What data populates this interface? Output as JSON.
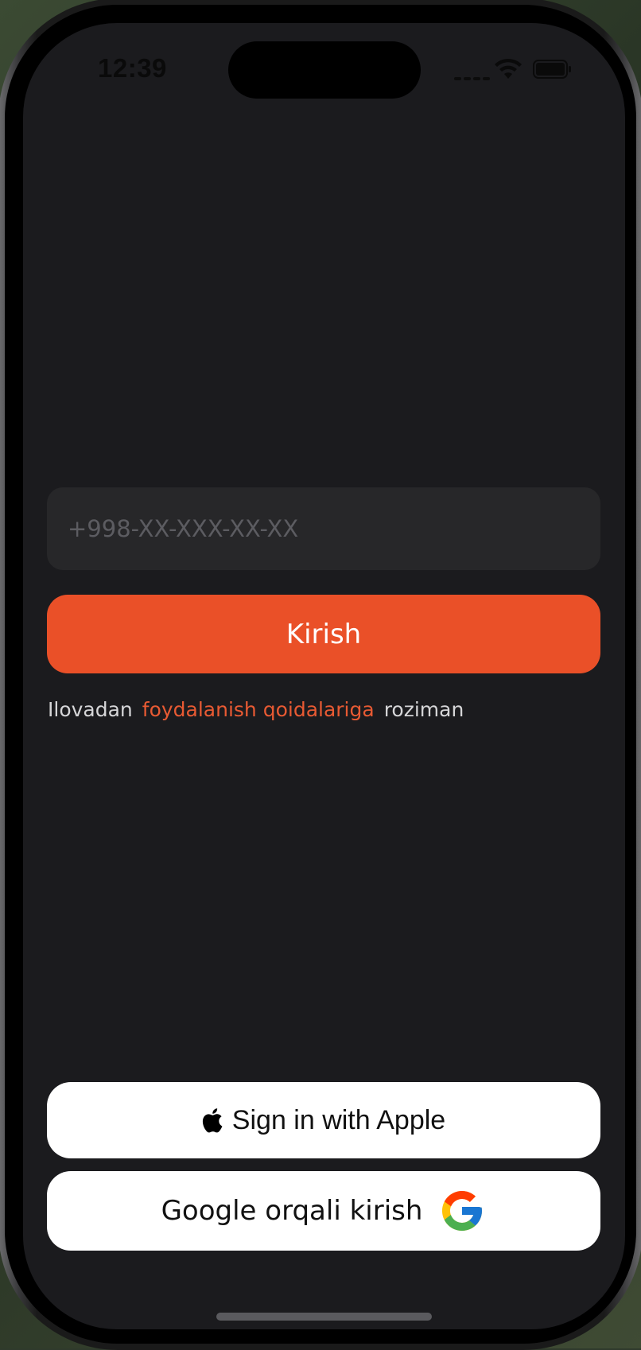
{
  "status_bar": {
    "time": "12:39"
  },
  "login": {
    "phone_placeholder": "+998-XX-XXX-XX-XX",
    "submit_label": "Kirish"
  },
  "terms": {
    "prefix": "Ilovadan",
    "link": "foydalanish qoidalariga",
    "suffix": "roziman"
  },
  "social": {
    "apple_label": "Sign in with Apple",
    "google_label": "Google orqali kirish"
  },
  "icons": {
    "apple": "apple-icon",
    "google": "google-icon",
    "wifi": "wifi-icon",
    "battery": "battery-icon"
  },
  "colors": {
    "accent": "#EA5028",
    "background": "#1B1B1E",
    "input_background": "#272729"
  }
}
